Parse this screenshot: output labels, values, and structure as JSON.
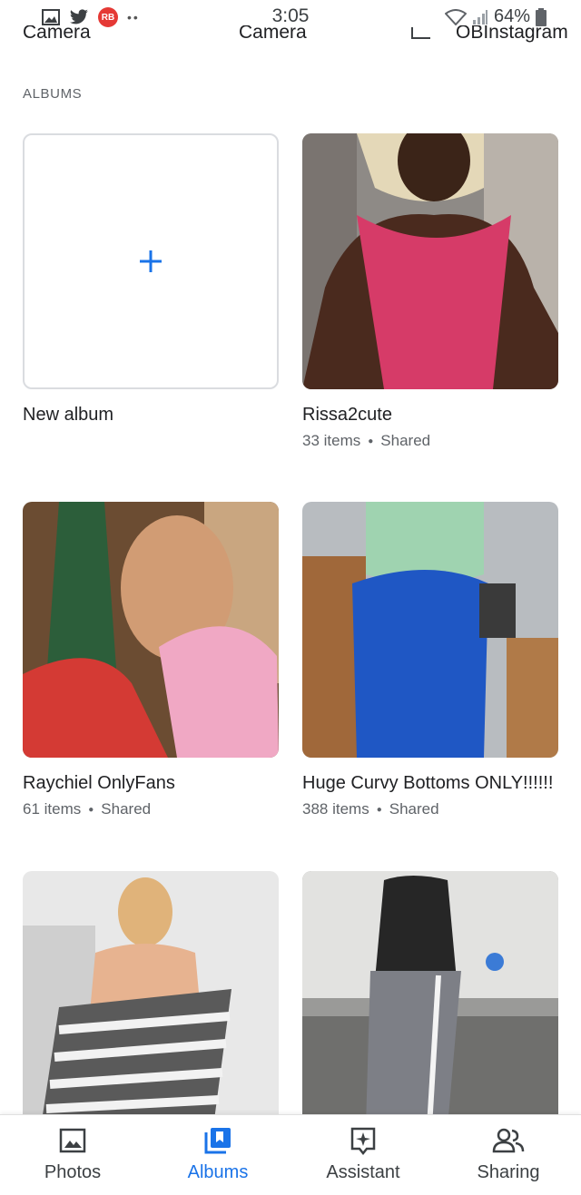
{
  "status_bar": {
    "time": "3:05",
    "battery": "64%",
    "badge": "RB"
  },
  "top_row_cut": [
    "Camera",
    "Camera",
    "OBInstagram"
  ],
  "section_label": "ALBUMS",
  "albums": [
    {
      "name": "New album",
      "items": "",
      "shared": ""
    },
    {
      "name": "Rissa2cute",
      "items": "33 items",
      "shared": "Shared"
    },
    {
      "name": "Raychiel OnlyFans",
      "items": "61 items",
      "shared": "Shared"
    },
    {
      "name": "Huge Curvy Bottoms ONLY!!!!!!",
      "items": "388 items",
      "shared": "Shared"
    },
    {
      "name": "",
      "items": "",
      "shared": ""
    },
    {
      "name": "",
      "items": "",
      "shared": ""
    }
  ],
  "bottom_nav": [
    {
      "label": "Photos",
      "icon": "photo-icon",
      "active": false
    },
    {
      "label": "Albums",
      "icon": "albums-icon",
      "active": true
    },
    {
      "label": "Assistant",
      "icon": "assistant-icon",
      "active": false
    },
    {
      "label": "Sharing",
      "icon": "sharing-icon",
      "active": false
    }
  ],
  "colors": {
    "accent": "#1a73e8",
    "text": "#202124",
    "secondary": "#5f6368"
  }
}
